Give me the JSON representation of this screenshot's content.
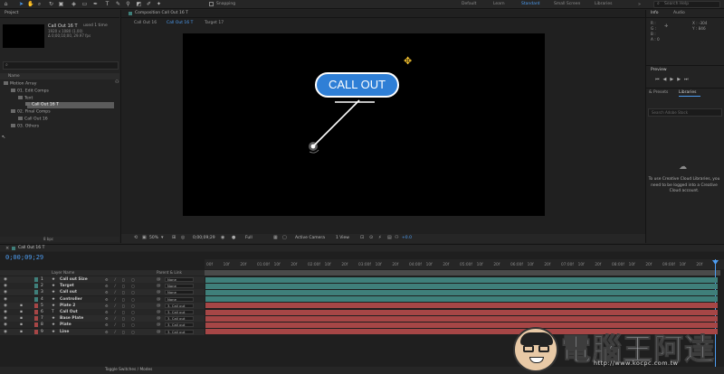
{
  "toolbar": {
    "snapping_label": "Snapping",
    "workspaces": [
      "Default",
      "Learn",
      "Standard",
      "Small Screen",
      "Libraries"
    ],
    "active_workspace": "Standard",
    "search_placeholder": "Search Help"
  },
  "project": {
    "panel_title": "Project",
    "comp_name": "Call Out 16 T",
    "used_count": "used 1 time",
    "comp_size": "1920 x 1080 (1.00)",
    "comp_duration": "Δ 0;00;10;00, 29.97 fps",
    "name_header": "Name",
    "tree": [
      {
        "label": "Motion Array",
        "indent": 0
      },
      {
        "label": "01. Edit Comps",
        "indent": 1
      },
      {
        "label": "Text",
        "indent": 2
      },
      {
        "label": "Call Out 16 T",
        "indent": 3,
        "selected": true
      },
      {
        "label": "02. Final Comps",
        "indent": 1
      },
      {
        "label": "Call Out 16",
        "indent": 2
      },
      {
        "label": "03. Others",
        "indent": 1
      }
    ],
    "footer": "8 bpc"
  },
  "composition": {
    "panel_title": "Composition Call Out 16 T",
    "tabs": [
      "Call Out 16",
      "Call Out 16 T",
      "Target 17"
    ],
    "active_tab": "Call Out 16 T",
    "callout_text": "CALL OUT",
    "zoom": "50%",
    "timecode": "0;00;09;29",
    "resolution": "Full",
    "camera": "Active Camera",
    "view": "1 View",
    "exposure": "+0.0"
  },
  "info": {
    "tabs": [
      "Info",
      "Audio"
    ],
    "x": "X : -304",
    "y": "Y : 846",
    "rgba": [
      "R :",
      "G :",
      "B :",
      "A : 0"
    ]
  },
  "preview": {
    "title": "Preview"
  },
  "libraries": {
    "tabs": [
      "& Presets",
      "Libraries"
    ],
    "search_placeholder": "Search Adobe Stock",
    "message": "To use Creative Cloud Libraries, you need to be logged into a Creative Cloud account."
  },
  "timeline": {
    "tab": "Call Out 16 T",
    "timecode": "0;00;09;29",
    "layer_header": "Layer Name",
    "parent_header": "Parent & Link",
    "ticks": [
      "00f",
      "10f",
      "20f",
      "01:00f",
      "10f",
      "20f",
      "02:00f",
      "10f",
      "20f",
      "03:00f",
      "10f",
      "20f",
      "04:00f",
      "10f",
      "20f",
      "05:00f",
      "10f",
      "20f",
      "06:00f",
      "10f",
      "20f",
      "07:00f",
      "10f",
      "20f",
      "08:00f",
      "10f",
      "20f",
      "09:00f",
      "10f",
      "20f"
    ],
    "layers": [
      {
        "num": "1",
        "name": "Call out Size",
        "parent": "None",
        "color": "#3f7f7a"
      },
      {
        "num": "2",
        "name": "Target",
        "parent": "None",
        "color": "#3f7f7a"
      },
      {
        "num": "3",
        "name": "Call out",
        "parent": "None",
        "color": "#3f7f7a"
      },
      {
        "num": "4",
        "name": "Controller",
        "parent": "None",
        "color": "#3f7f7a"
      },
      {
        "num": "5",
        "name": "Plate 2",
        "parent": "3. Call out",
        "color": "#a64646"
      },
      {
        "num": "6",
        "name": "Call Out",
        "parent": "3. Call out",
        "color": "#a64646"
      },
      {
        "num": "7",
        "name": "Base Plate",
        "parent": "3. Call out",
        "color": "#a64646"
      },
      {
        "num": "8",
        "name": "Plate",
        "parent": "3. Call out",
        "color": "#a64646"
      },
      {
        "num": "9",
        "name": "Line",
        "parent": "3. Call out",
        "color": "#a64646"
      }
    ],
    "footer_label": "Toggle Switches / Modes"
  },
  "watermark": {
    "text": "電腦王阿達",
    "url": "http://www.kocpc.com.tw"
  }
}
